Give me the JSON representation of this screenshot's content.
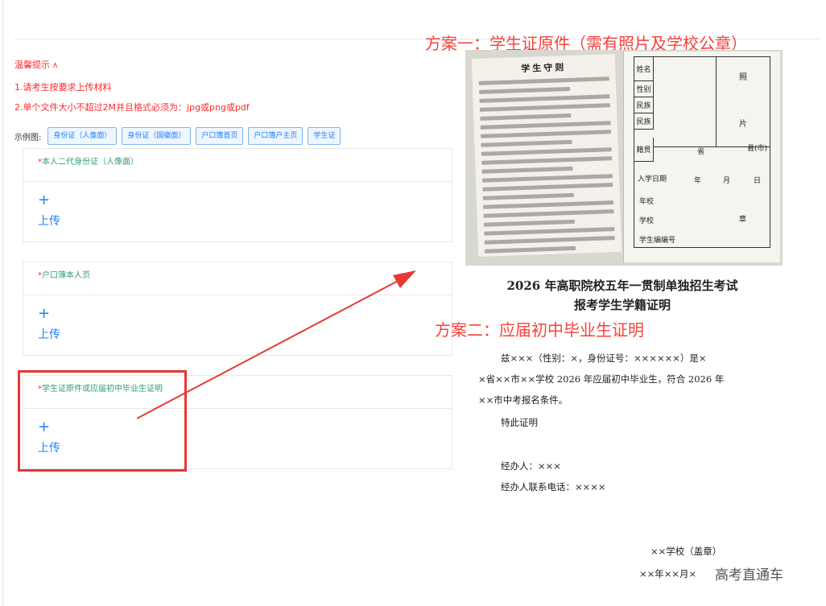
{
  "tips": {
    "header": "温馨提示",
    "line1": "1.请考生按要求上传材料",
    "line2": "2.单个文件大小不超过2M并且格式必须为：jpg或png或pdf"
  },
  "examples": {
    "label": "示例图:",
    "buttons": [
      "身份证（人像面）",
      "身份证（国徽面）",
      "户口簿首页",
      "户口簿户主页",
      "学生证"
    ]
  },
  "upload_cards": [
    {
      "title": "本人二代身份证（人像面）",
      "plus": "+",
      "action": "上传"
    },
    {
      "title": "户口簿本人页",
      "plus": "+",
      "action": "上传"
    },
    {
      "title": "学生证原件或应届初中毕业生证明",
      "plus": "+",
      "action": "上传"
    }
  ],
  "scheme1": {
    "title": "方案一：学生证原件（需有照片及学校公章）",
    "card": {
      "rules_title": "学生守则",
      "fields": {
        "name": "姓名",
        "gender": "性别",
        "ethnicity": "民族",
        "ethnicity2": "民族",
        "native": "籍贯",
        "photo1": "照",
        "photo2": "片",
        "province": "省",
        "county": "县(市)",
        "enroll_date": "入学日期",
        "year": "年",
        "month": "月",
        "day": "日",
        "school_label": "年校",
        "school_label2": "学校",
        "stamp": "章",
        "student_no": "学生编编号"
      }
    }
  },
  "scheme2": {
    "title": "方案二：应届初中毕业生证明",
    "cert": {
      "title_line1": "2026 年高职院校五年一贯制单独招生考试",
      "title_line2": "报考学生学籍证明",
      "body1": "兹×××（性别：×，身份证号：××××××）是×",
      "body2": "×省××市××学校 2026 年应届初中毕业生，符合 2026 年",
      "body3": "××市中考报名条件。",
      "body4": "特此证明",
      "handler": "经办人：×××",
      "phone": "经办人联系电话：××××",
      "school_seal": "××学校（盖章）",
      "date": "××年××月×"
    }
  },
  "watermark": "高考直通车",
  "colors": {
    "accent_red": "#f4433a",
    "link_blue": "#1e80ff",
    "title_green": "#2fa06f"
  }
}
